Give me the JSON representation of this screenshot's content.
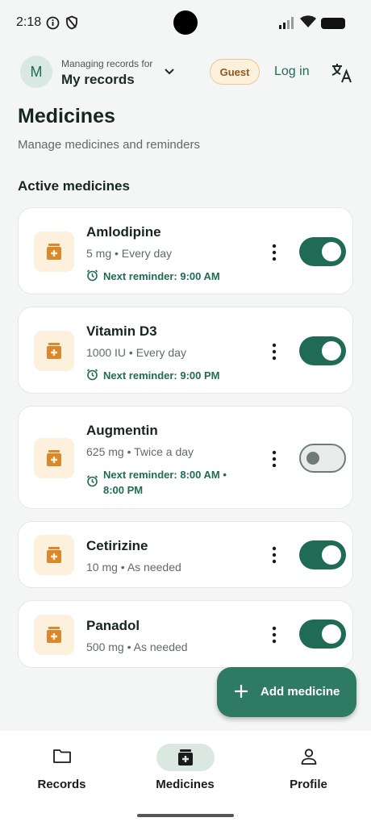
{
  "status_bar": {
    "time": "2:18"
  },
  "header": {
    "avatar_initial": "M",
    "account_caption": "Managing records for",
    "account_name": "My records",
    "guest_badge": "Guest",
    "login_label": "Log in",
    "translate_icon": "translate-icon"
  },
  "page": {
    "title": "Medicines",
    "subtitle": "Manage medicines and reminders",
    "section_title": "Active medicines"
  },
  "medicines": [
    {
      "name": "Amlodipine",
      "dose": "5 mg • Every day",
      "reminder": "Next reminder: 9:00 AM",
      "enabled": true
    },
    {
      "name": "Vitamin D3",
      "dose": "1000 IU • Every day",
      "reminder": "Next reminder: 9:00 PM",
      "enabled": true
    },
    {
      "name": "Augmentin",
      "dose": "625 mg • Twice a day",
      "reminder": "Next reminder: 8:00 AM • 8:00 PM",
      "enabled": false
    },
    {
      "name": "Cetirizine",
      "dose": "10 mg • As needed",
      "reminder": "",
      "enabled": true
    },
    {
      "name": "Panadol",
      "dose": "500 mg • As needed",
      "reminder": "",
      "enabled": true
    }
  ],
  "fab": {
    "label": "Add medicine"
  },
  "bottom_nav": {
    "items": [
      {
        "label": "Records",
        "icon": "folder-icon",
        "active": false
      },
      {
        "label": "Medicines",
        "icon": "medicine-icon",
        "active": true
      },
      {
        "label": "Profile",
        "icon": "person-icon",
        "active": false
      }
    ]
  },
  "colors": {
    "accent": "#1f6b55",
    "background": "#f3f6f4",
    "medicine_icon_bg": "#fdf0dc",
    "medicine_icon": "#d9892b"
  }
}
